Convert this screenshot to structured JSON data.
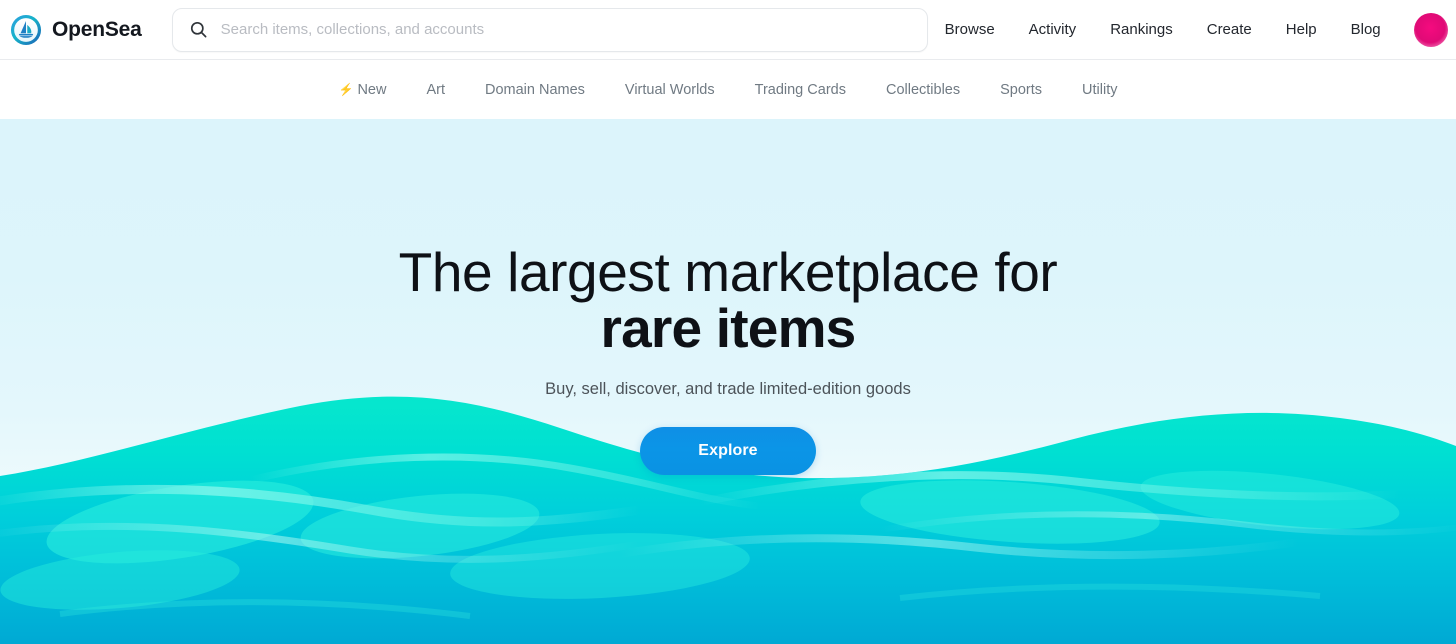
{
  "brand": {
    "name": "OpenSea",
    "logo_icon": "opensea-sailboat-logo",
    "logo_colors": [
      "#2081e2",
      "#00b8c8",
      "#1868b7"
    ]
  },
  "search": {
    "icon": "search-icon",
    "value": "",
    "placeholder": "Search items, collections, and accounts"
  },
  "top_nav": {
    "items": [
      {
        "label": "Browse"
      },
      {
        "label": "Activity"
      },
      {
        "label": "Rankings"
      },
      {
        "label": "Create"
      },
      {
        "label": "Help"
      },
      {
        "label": "Blog"
      }
    ],
    "avatar": {
      "icon": "user-avatar",
      "color": "#e8117f"
    }
  },
  "category_nav": {
    "items": [
      {
        "label": "New",
        "icon": "lightning-bolt-icon",
        "glyph": "⚡"
      },
      {
        "label": "Art",
        "icon": null
      },
      {
        "label": "Domain Names",
        "icon": null
      },
      {
        "label": "Virtual Worlds",
        "icon": null
      },
      {
        "label": "Trading Cards",
        "icon": null
      },
      {
        "label": "Collectibles",
        "icon": null
      },
      {
        "label": "Sports",
        "icon": null
      },
      {
        "label": "Utility",
        "icon": null
      }
    ]
  },
  "hero": {
    "title_line1": "The largest marketplace for",
    "title_line2": "rare items",
    "subtitle": "Buy, sell, discover, and trade limited-edition goods",
    "cta_label": "Explore",
    "cta_color": "#0a93e4",
    "background_top_color": "#dcf4fb",
    "background_bottom_color": "#ffffff",
    "wave": {
      "icon": "ocean-wave-graphic",
      "top_color": "#00e6cf",
      "mid_color": "#00d4dc",
      "bottom_color": "#00acd6",
      "highlight_color": "#5cf2e4"
    }
  }
}
